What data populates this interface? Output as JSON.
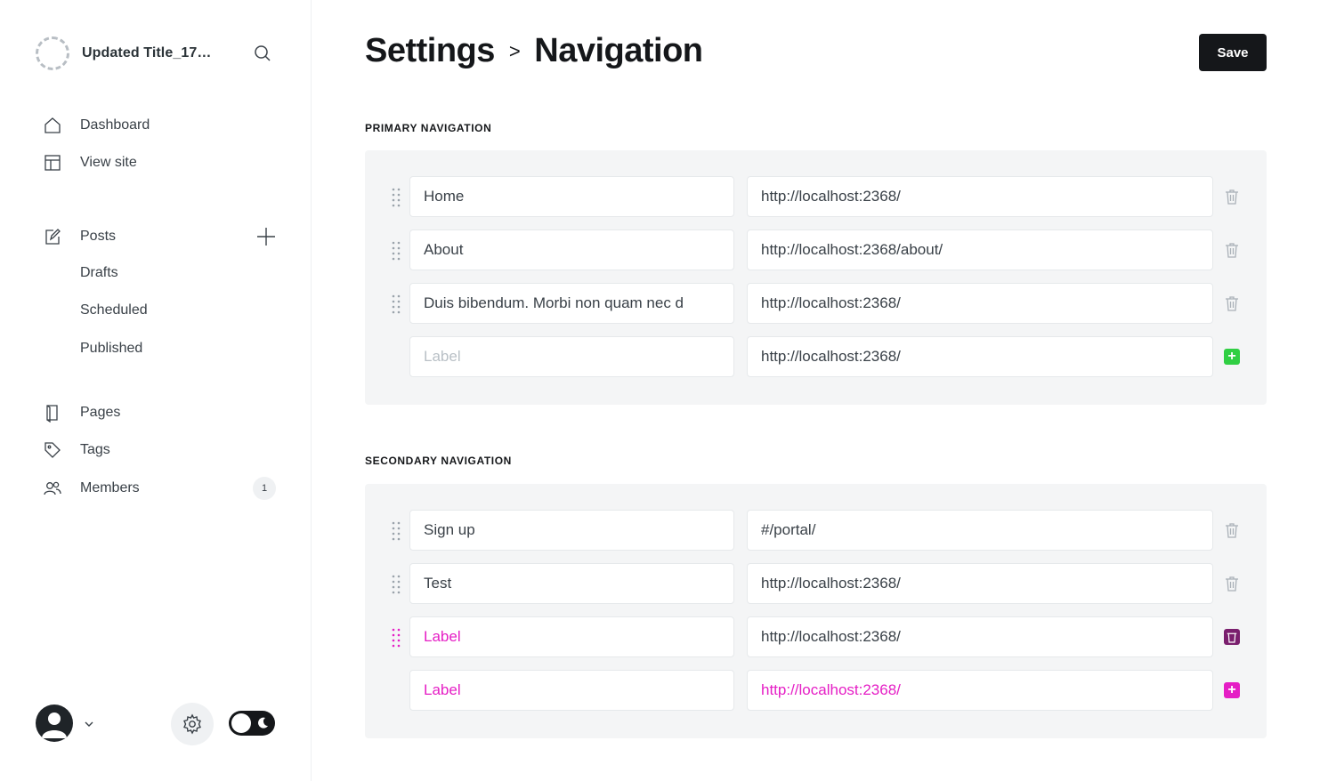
{
  "sidebar": {
    "site_title": "Updated Title_17…",
    "nav": {
      "dashboard": "Dashboard",
      "view_site": "View site",
      "posts": "Posts",
      "drafts": "Drafts",
      "scheduled": "Scheduled",
      "published": "Published",
      "pages": "Pages",
      "tags": "Tags",
      "members": "Members",
      "members_count": "1"
    }
  },
  "header": {
    "breadcrumb_root": "Settings",
    "breadcrumb_separator": ">",
    "breadcrumb_current": "Navigation",
    "save_label": "Save"
  },
  "primary": {
    "title": "PRIMARY NAVIGATION",
    "items": [
      {
        "label": "Home",
        "url": "http://localhost:2368/"
      },
      {
        "label": "About",
        "url": "http://localhost:2368/about/"
      },
      {
        "label": "Duis bibendum. Morbi non quam nec d",
        "url": "http://localhost:2368/"
      }
    ],
    "new_item": {
      "label_placeholder": "Label",
      "url": "http://localhost:2368/"
    }
  },
  "secondary": {
    "title": "SECONDARY NAVIGATION",
    "items": [
      {
        "label": "Sign up",
        "url": "#/portal/"
      },
      {
        "label": "Test",
        "url": "http://localhost:2368/"
      },
      {
        "label": "Label",
        "url": "http://localhost:2368/"
      }
    ],
    "new_item": {
      "label_placeholder": "Label",
      "url": "http://localhost:2368/"
    }
  },
  "colors": {
    "accent_green": "#30cf43",
    "accent_pink": "#e51ec5",
    "dark": "#15171a"
  },
  "icons": [
    "search-icon",
    "house-icon",
    "layout-icon",
    "edit-icon",
    "plus-icon",
    "page-icon",
    "tag-icon",
    "members-icon",
    "user-icon",
    "chevron-down-icon",
    "gear-icon",
    "moon-icon",
    "drag-handle-icon",
    "trash-icon"
  ]
}
